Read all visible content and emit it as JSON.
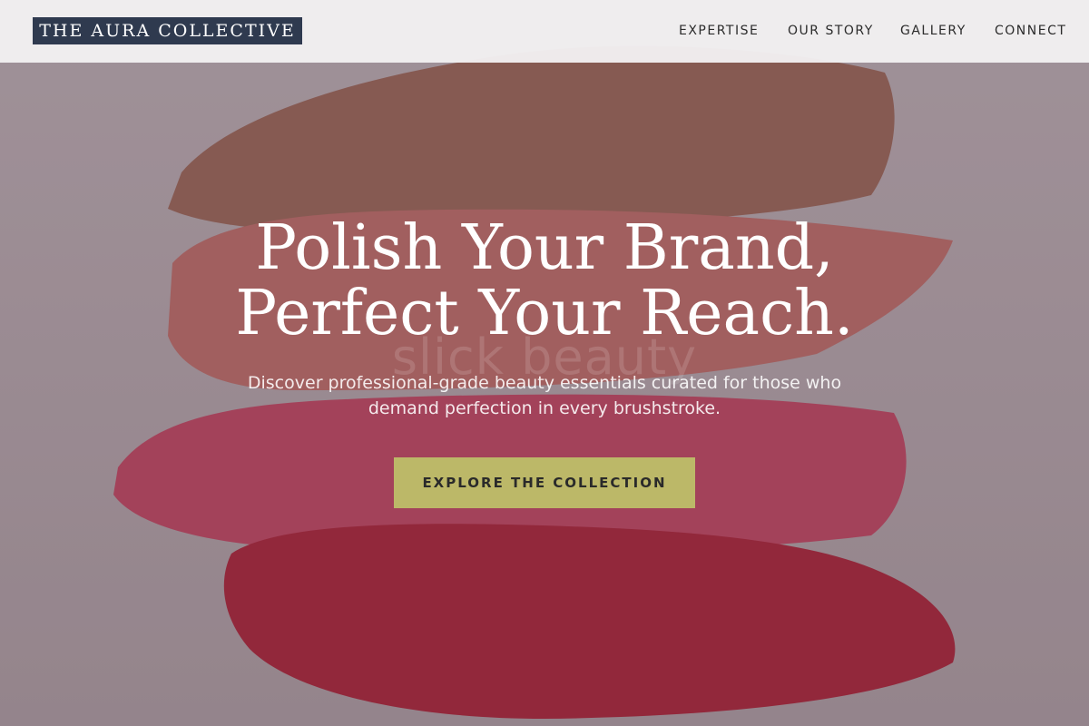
{
  "header": {
    "logo": "THE AURA COLLECTIVE",
    "nav": [
      {
        "label": "EXPERTISE"
      },
      {
        "label": "OUR STORY"
      },
      {
        "label": "GALLERY"
      },
      {
        "label": "CONNECT"
      }
    ]
  },
  "hero": {
    "headline_line1": "Polish Your Brand,",
    "headline_line2": "Perfect Your Reach.",
    "subtitle": "Discover professional-grade beauty essentials curated for those who demand perfection in every brushstroke.",
    "cta_label": "EXPLORE THE COLLECTION",
    "watermark": "slick beauty"
  },
  "colors": {
    "logo_bg": "#2f3a4f",
    "cta_bg": "#bcb868",
    "navbar_bg": "#f2f0f1",
    "swatch_brown": "#8f5a4c",
    "swatch_rose": "#b4615d",
    "swatch_pink": "#b83a57",
    "swatch_red": "#a0152b"
  }
}
